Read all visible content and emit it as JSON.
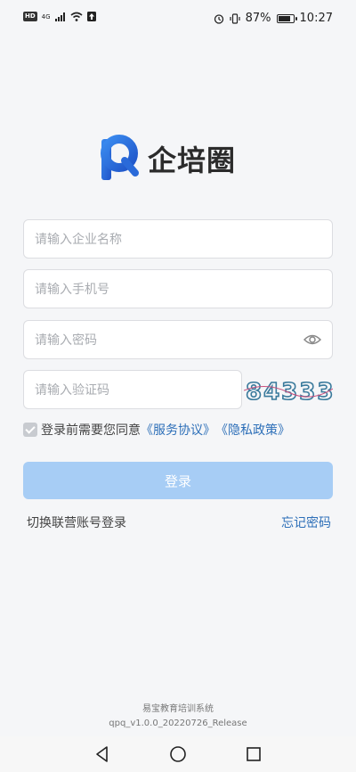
{
  "status_bar": {
    "hd": "HD",
    "network": "4G",
    "battery_text": "87%",
    "battery_level": 0.87,
    "time": "10:27",
    "icons": [
      "signal-icon",
      "wifi-icon",
      "upload-icon",
      "alarm-icon",
      "vibrate-icon",
      "battery-icon"
    ]
  },
  "logo": {
    "text": "企培圈",
    "accent": "#2f6fe3"
  },
  "form": {
    "company_placeholder": "请输入企业名称",
    "phone_placeholder": "请输入手机号",
    "password_placeholder": "请输入密码",
    "captcha_placeholder": "请输入验证码",
    "captcha_code": "84333"
  },
  "agreement": {
    "prefix": "登录前需要您同意",
    "service_link": "《服务协议》",
    "privacy_link": "《隐私政策》"
  },
  "login_button": "登录",
  "links": {
    "switch_account": "切换联营账号登录",
    "forgot_password": "忘记密码"
  },
  "footer": {
    "system_name": "易宝教育培训系统",
    "version": "qpq_v1.0.0_20220726_Release"
  },
  "colors": {
    "primary": "#2f6fe3",
    "link": "#2d6fb8",
    "button_disabled": "#a7cdf5"
  }
}
